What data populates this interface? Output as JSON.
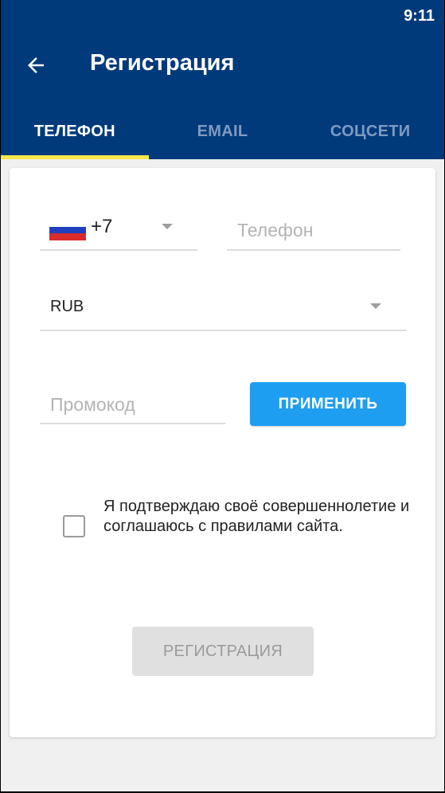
{
  "status_bar": {
    "time": "9:11"
  },
  "app_bar": {
    "title": "Регистрация",
    "back_icon": "arrow-left-icon",
    "background_color": "#003a7b"
  },
  "tabs": [
    {
      "label": "ТЕЛЕФОН",
      "active": true
    },
    {
      "label": "EMAIL",
      "active": false
    },
    {
      "label": "СОЦСЕТИ",
      "active": false
    }
  ],
  "tab_indicator_color": "#f5e84a",
  "form": {
    "country": {
      "flag_icon": "russia-flag-icon",
      "code": "+7"
    },
    "phone": {
      "placeholder": "Телефон",
      "value": ""
    },
    "currency": {
      "value": "RUB"
    },
    "promo": {
      "placeholder": "Промокод",
      "value": ""
    },
    "apply_label": "ПРИМЕНИТЬ",
    "apply_color": "#1e9ef0",
    "agree": {
      "checked": false,
      "text": "Я подтверждаю своё совершеннолетие и соглашаюсь с правилами сайта."
    },
    "register_label": "РЕГИСТРАЦИЯ"
  }
}
